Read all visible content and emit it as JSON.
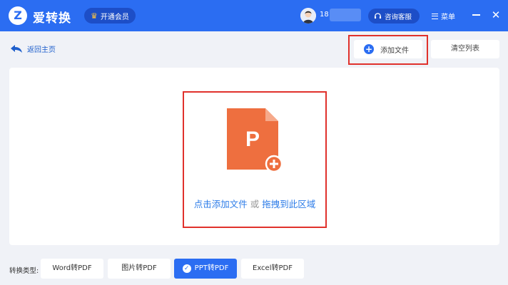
{
  "header": {
    "logo_letter": "Z",
    "app_title": "爱转换",
    "vip_label": "开通会员",
    "user_name": "18",
    "service_label": "咨询客服",
    "menu_label": "菜单",
    "close_glyph": "✕"
  },
  "toolbar": {
    "back_label": "返回主页",
    "add_file_label": "添加文件",
    "clear_list_label": "清空列表"
  },
  "drop_zone": {
    "icon_letter": "P",
    "click_add_text": "点击添加文件",
    "or_text": "或",
    "drag_text": "拖拽到此区域"
  },
  "convert_types": {
    "label": "转换类型:",
    "options": [
      "Word转PDF",
      "图片转PDF",
      "PPT转PDF",
      "Excel转PDF"
    ],
    "selected": "PPT转PDF"
  },
  "colors": {
    "brand_blue": "#2b6df2",
    "ppt_orange": "#ee6f3f",
    "highlight_red": "#e0312c",
    "link_blue": "#2b7be8"
  },
  "icons": {
    "logo": "z-logo-icon",
    "vip": "crown-icon",
    "service": "headset-icon",
    "menu": "hamburger-icon",
    "back": "back-arrow-icon",
    "add": "plus-circle-icon",
    "file": "ppt-file-icon",
    "selected": "check-circle-icon"
  }
}
